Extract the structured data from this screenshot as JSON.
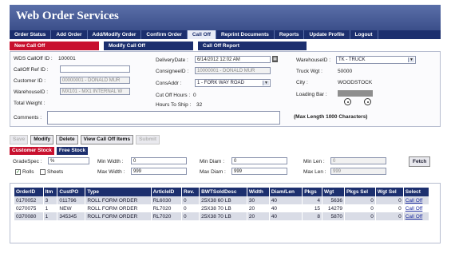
{
  "app": {
    "title": "Web Order Services"
  },
  "nav": [
    "Order Status",
    "Add Order",
    "Add/Modify Order",
    "Confirm Order",
    "Call Off",
    "Reprint Documents",
    "Reports",
    "Update Profile",
    "Logout"
  ],
  "tabs": {
    "new": "New Call Off",
    "modify": "Modify Call Off",
    "report": "Call Off Report"
  },
  "form": {
    "wds_label": "WDS CallOff ID :",
    "wds_value": "100001",
    "ref_label": "CallOff Ref ID :",
    "ref_value": "",
    "cust_label": "Customer ID :",
    "cust_value": "00000001 - DONALD MUR",
    "wh_label": "WarehouseID :",
    "wh_value": "MX101 - MX1 INTERNAL W",
    "weight_label": "Total Weight :",
    "comments_label": "Comments :",
    "comments_value": "",
    "delivery_label": "DeliveryDate :",
    "delivery_value": "6/14/2012 12:02 AM",
    "consignee_label": "ConsigneeID :",
    "consignee_value": "10000001 - DONALD MUR",
    "consaddr_label": "ConsAddr :",
    "consaddr_value": "1 - FORK WAY ROAD",
    "cutoff_label": "Cut Off Hours :",
    "cutoff_value": "0",
    "ship_label": "Hours To Ship :",
    "ship_value": "32",
    "wh2_label": "WarehouseID :",
    "wh2_value": "TK - TRUCK",
    "truck_label": "Truck Wgt :",
    "truck_value": "50000",
    "city_label": "City :",
    "city_value": "WOODSTOCK",
    "loading_label": "Loading Bar :",
    "max_note": "(Max Length 1000 Characters)"
  },
  "buttons": {
    "save": "Save",
    "modify": "Modify",
    "delete": "Delete",
    "view": "View Call Off Items",
    "submit": "Submit"
  },
  "stock_tabs": {
    "customer": "Customer Stock",
    "free": "Free Stock"
  },
  "filters": {
    "grade_label": "GradeSpec :",
    "grade_value": "%",
    "minw_label": "Min Width :",
    "minw_value": "0",
    "maxw_label": "Max Width :",
    "maxw_value": "999",
    "mind_label": "Min Diam :",
    "mind_value": "0",
    "maxd_label": "Max Diam :",
    "maxd_value": "999",
    "minl_label": "Min Len :",
    "minl_value": "0",
    "maxl_label": "Max Len :",
    "maxl_value": "999",
    "rolls_label": "Rolls",
    "rolls_checked": true,
    "sheets_label": "Sheets",
    "sheets_checked": false,
    "fetch": "Fetch"
  },
  "table": {
    "headers": [
      "OrderID",
      "Itm",
      "CustPO",
      "Type",
      "ArticleID",
      "Rev.",
      "BWTSoldDesc",
      "Width",
      "Diam/Len",
      "Pkgs",
      "Wgt",
      "Pkgs Sel",
      "Wgt Sel",
      "Select"
    ],
    "rows": [
      [
        "0170052",
        "3",
        "011796",
        "ROLL FORM ORDER",
        "RL6030",
        "0",
        "25X38 60 LB",
        "30",
        "40",
        "4",
        "5636",
        "0",
        "0",
        "Call Off"
      ],
      [
        "0270075",
        "1",
        "NEW",
        "ROLL FORM ORDER",
        "RL7020",
        "0",
        "25X38 70 LB",
        "20",
        "40",
        "15",
        "14279",
        "0",
        "0",
        "Call Off"
      ],
      [
        "0370080",
        "1",
        "345345",
        "ROLL FORM ORDER",
        "RL7020",
        "0",
        "25X38 70 LB",
        "20",
        "40",
        "8",
        "5870",
        "0",
        "0",
        "Call Off"
      ]
    ]
  }
}
